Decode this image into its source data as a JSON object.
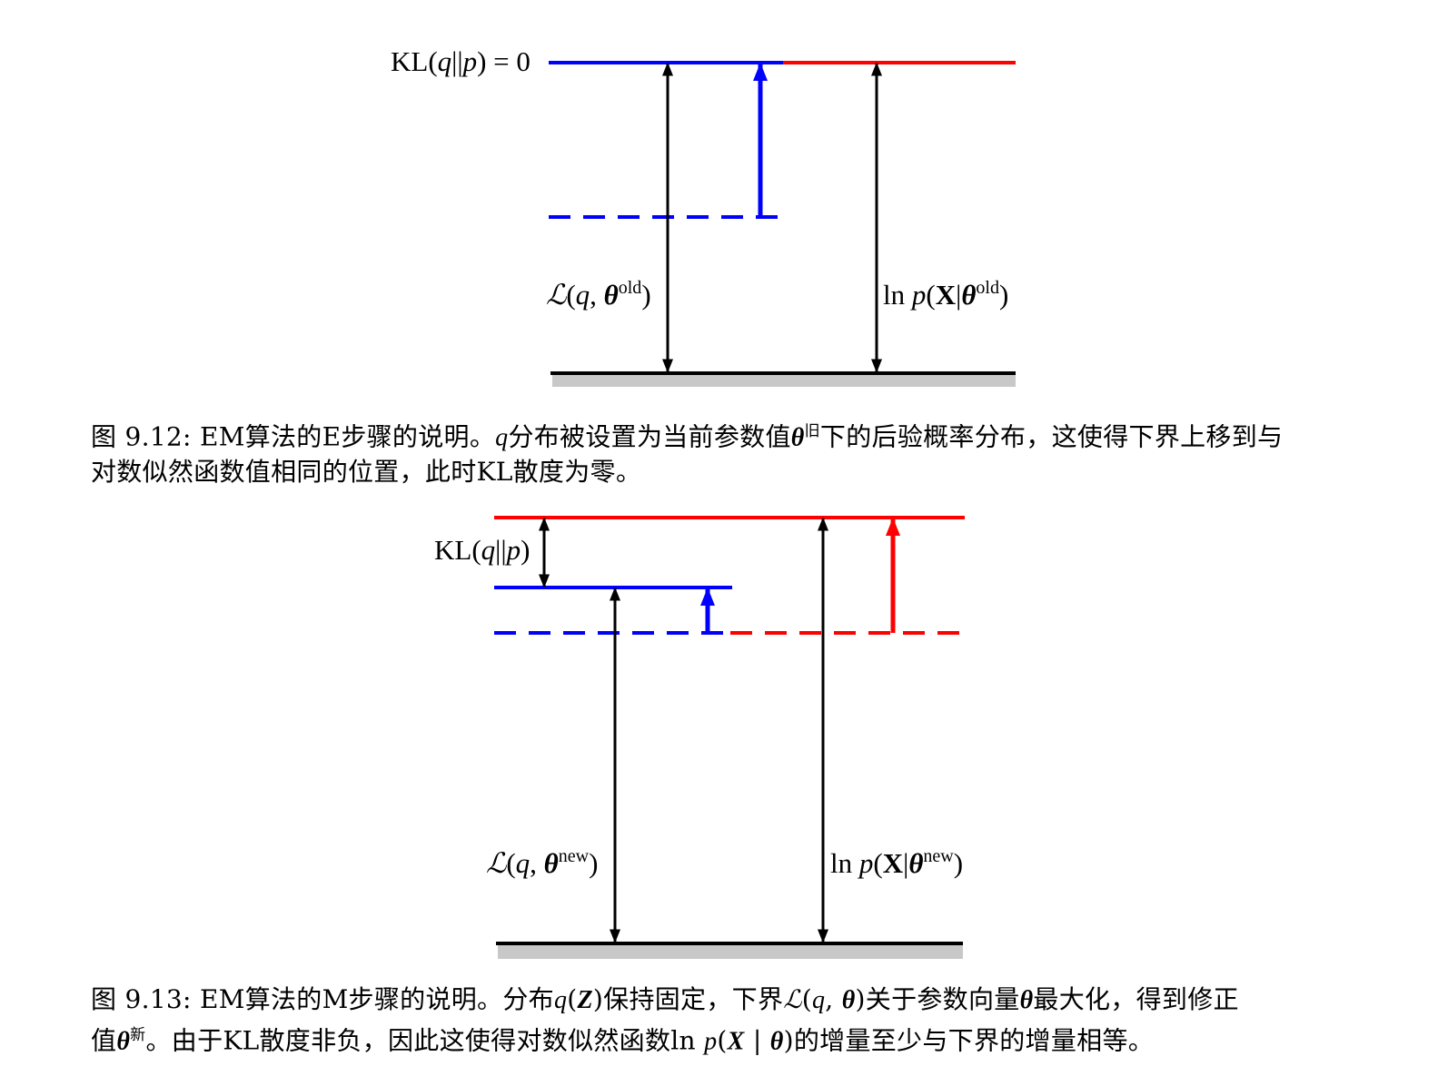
{
  "figure_1": {
    "labels": {
      "kl_prefix": "KL(",
      "kl_q": "q",
      "kl_sep": "||",
      "kl_p": "p",
      "kl_suffix": ") = 0",
      "lb_L": "ℒ",
      "lb_open": "(",
      "lb_q": "q",
      "lb_comma": ", ",
      "lb_theta": "θ",
      "lb_sup": "old",
      "lb_close": ")",
      "ll_ln": "ln ",
      "ll_p": "p",
      "ll_open": "(",
      "ll_X": "X",
      "ll_bar": "|",
      "ll_theta": "θ",
      "ll_sup": "old",
      "ll_close": ")"
    },
    "caption": {
      "line1_a": "图 9.12: EM算法的E步骤的说明。",
      "line1_q": "q",
      "line1_b": "分布被设置为当前参数值",
      "line1_theta": "θ",
      "line1_sup": "旧",
      "line1_c": "下的后验概率分布，这使得下界上移到与",
      "line2": "对数似然函数值相同的位置，此时KL散度为零。"
    }
  },
  "figure_2": {
    "labels": {
      "kl_prefix": "KL(",
      "kl_q": "q",
      "kl_sep": "||",
      "kl_p": "p",
      "kl_suffix": ")",
      "lb_L": "ℒ",
      "lb_open": "(",
      "lb_q": "q",
      "lb_comma": ", ",
      "lb_theta": "θ",
      "lb_sup": "new",
      "lb_close": ")",
      "ll_ln": "ln ",
      "ll_p": "p",
      "ll_open": "(",
      "ll_X": "X",
      "ll_bar": "|",
      "ll_theta": "θ",
      "ll_sup": "new",
      "ll_close": ")"
    },
    "caption": {
      "line1_a": "图 9.13: EM算法的M步骤的说明。分布",
      "line1_q": "q",
      "line1_open": "(",
      "line1_Z": "Z",
      "line1_close": ")",
      "line1_b": "保持固定，下界",
      "line1_L": "ℒ",
      "line1_Lopen": "(",
      "line1_Lq": "q",
      "line1_Lcomma": ", ",
      "line1_Ltheta": "θ",
      "line1_Lclose": ")",
      "line1_c": "关于参数向量",
      "line1_theta": "θ",
      "line1_d": "最大化，得到修正",
      "line2_a": "值",
      "line2_theta": "θ",
      "line2_sup": "新",
      "line2_b": "。由于KL散度非负，因此这使得对数似然函数",
      "line2_ln": "ln ",
      "line2_p": "p",
      "line2_open": "(",
      "line2_X": "X",
      "line2_bar": " | ",
      "line2_theta2": "θ",
      "line2_close": ")",
      "line2_c": "的增量至少与下界的增量相等。"
    }
  },
  "colors": {
    "blue": "#0000ff",
    "red": "#ff0000",
    "black": "#000000",
    "baseline_shadow": "#c8c8c8"
  }
}
